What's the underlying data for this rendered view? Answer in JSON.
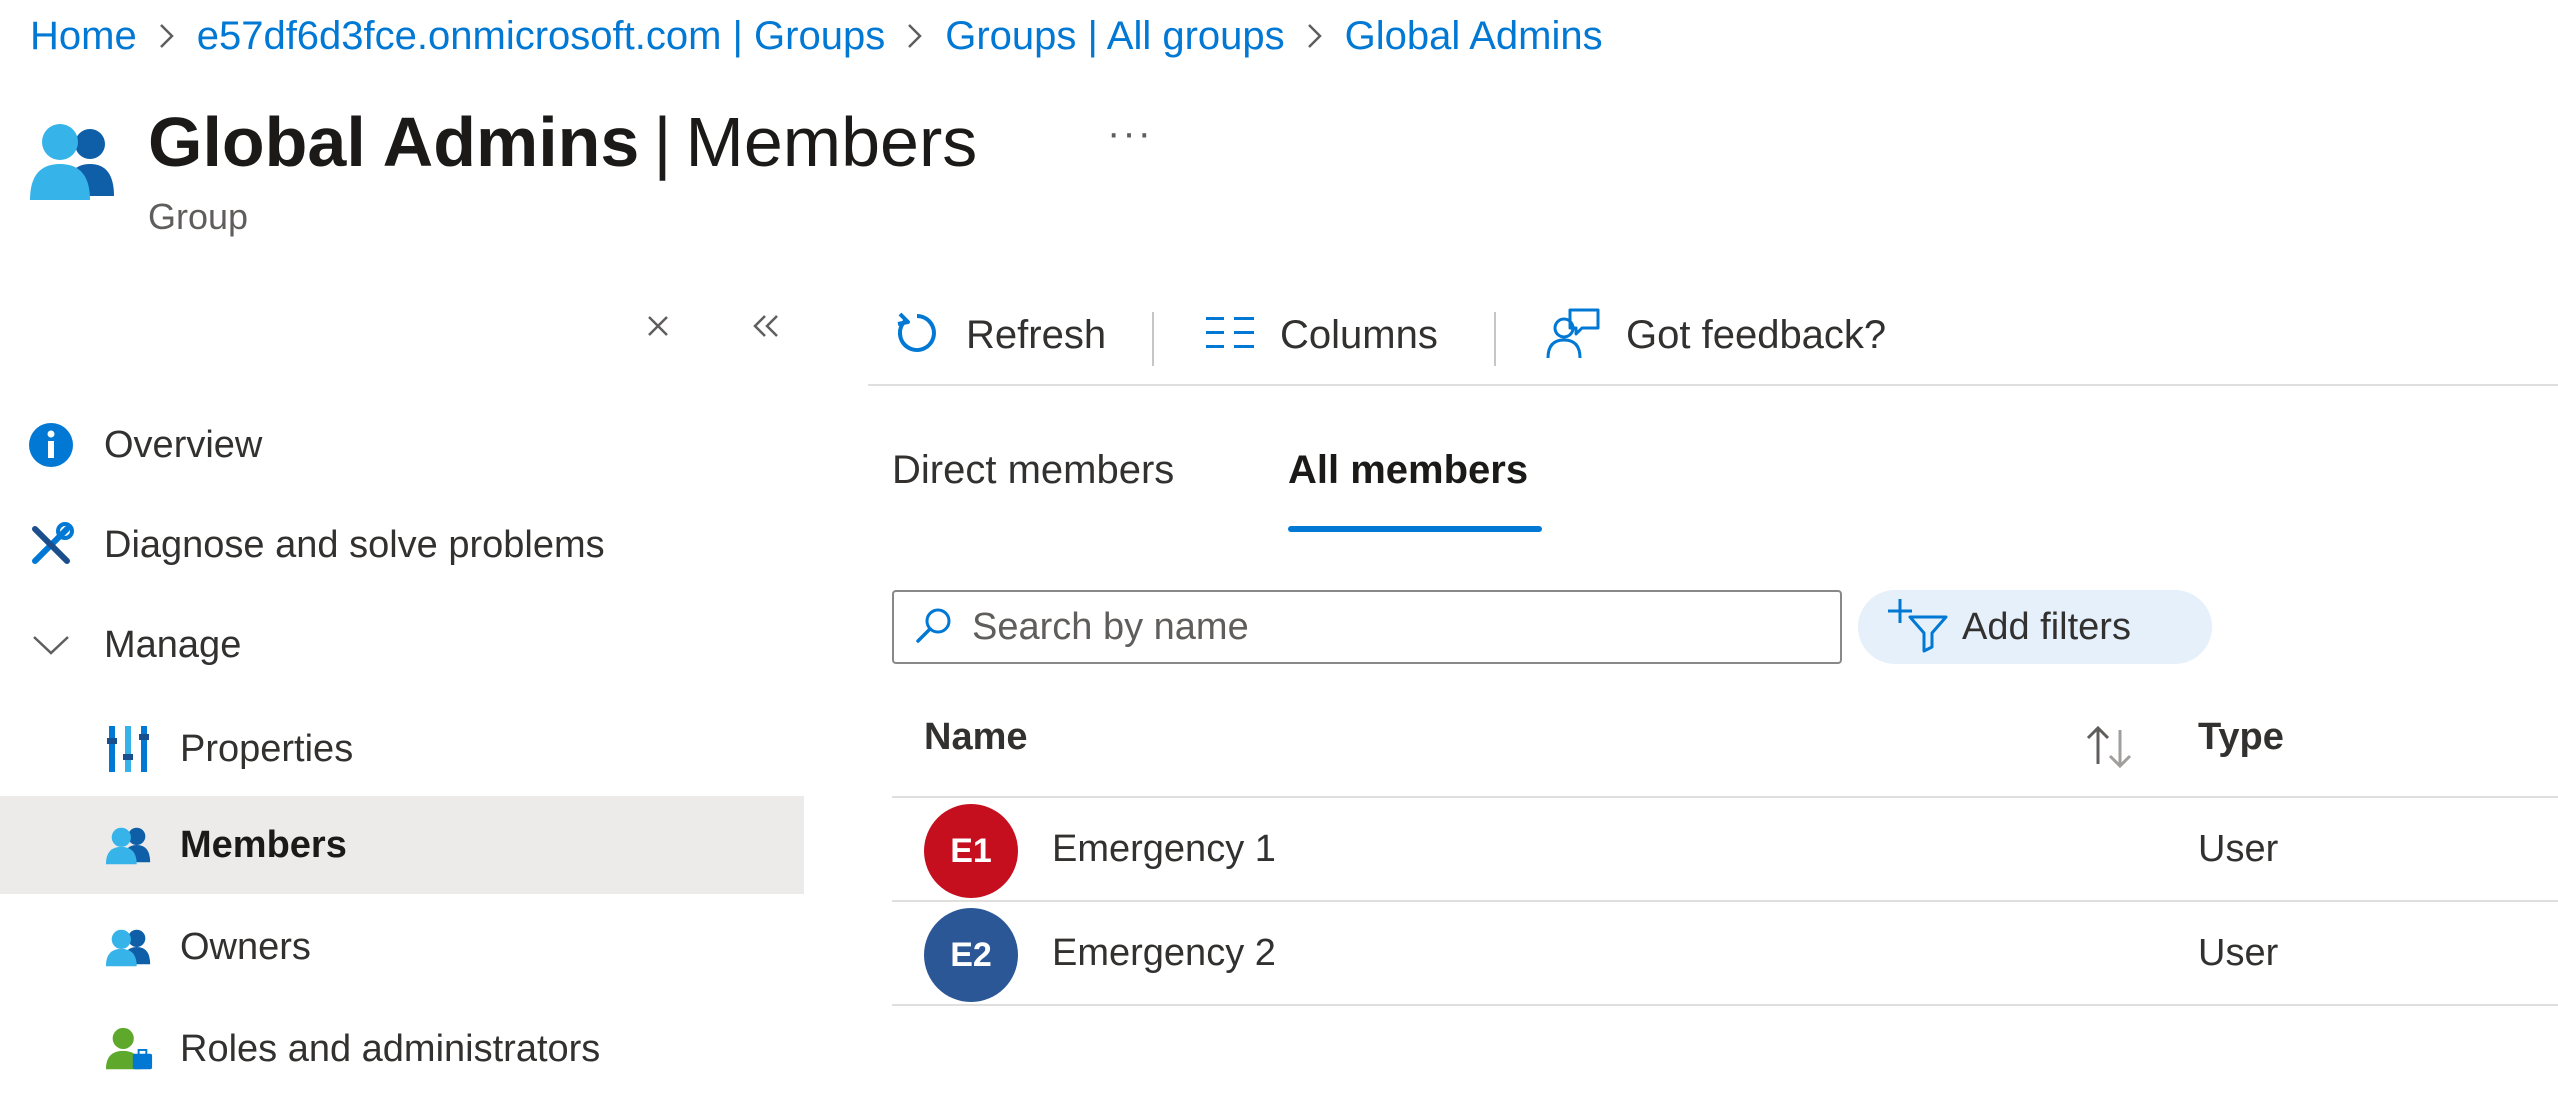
{
  "breadcrumb": {
    "items": [
      "Home",
      "e57df6d3fce.onmicrosoft.com | Groups",
      "Groups | All groups",
      "Global Admins"
    ]
  },
  "header": {
    "title": "Global Admins",
    "separator": "|",
    "section": "Members",
    "more": "···",
    "subtitle": "Group"
  },
  "sidebar": {
    "items": [
      {
        "label": "Overview",
        "icon": "info-icon"
      },
      {
        "label": "Diagnose and solve problems",
        "icon": "wrench-icon"
      },
      {
        "label": "Manage",
        "icon": "chevron-down-icon"
      },
      {
        "label": "Properties",
        "icon": "properties-icon"
      },
      {
        "label": "Members",
        "icon": "members-icon",
        "selected": true
      },
      {
        "label": "Owners",
        "icon": "owners-icon"
      },
      {
        "label": "Roles and administrators",
        "icon": "roles-icon"
      }
    ]
  },
  "toolbar": {
    "refresh": "Refresh",
    "columns": "Columns",
    "feedback": "Got feedback?"
  },
  "tabs": {
    "direct": "Direct members",
    "all": "All members",
    "active": "all"
  },
  "search": {
    "placeholder": "Search by name",
    "value": ""
  },
  "filters": {
    "label": "Add filters"
  },
  "table": {
    "columns": [
      "Name",
      "Type"
    ],
    "rows": [
      {
        "initials": "E1",
        "name": "Emergency 1",
        "type": "User",
        "avatar_color": "#c50f1f"
      },
      {
        "initials": "E2",
        "name": "Emergency 2",
        "type": "User",
        "avatar_color": "#2b5797"
      }
    ]
  },
  "colors": {
    "accent": "#0078d4",
    "selected_bg": "#edebe9",
    "filter_bg": "#e6f0fa"
  }
}
